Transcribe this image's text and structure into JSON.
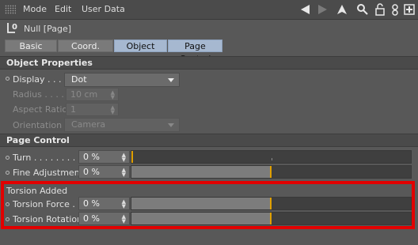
{
  "menubar": {
    "items": [
      "Mode",
      "Edit",
      "User Data"
    ]
  },
  "toolbar": {
    "icons": [
      "back-arrow-icon",
      "forward-arrow-icon",
      "up-arrow-icon",
      "search-icon",
      "lock-icon",
      "settings-icon",
      "new-panel-icon"
    ]
  },
  "object": {
    "name": "Null [Page]"
  },
  "tabs": [
    {
      "label": "Basic",
      "active": false
    },
    {
      "label": "Coord.",
      "active": false
    },
    {
      "label": "Object",
      "active": true
    },
    {
      "label": "Page Control",
      "active": true
    }
  ],
  "object_properties": {
    "header": "Object Properties",
    "display": {
      "label": "Display . . . .",
      "value": "Dot"
    },
    "radius": {
      "label": "Radius . . . .",
      "value": "10 cm"
    },
    "aspect_ratio": {
      "label": "Aspect Ratio",
      "value": "1"
    },
    "orientation": {
      "label": "Orientation",
      "value": "Camera"
    }
  },
  "page_control": {
    "header": "Page Control",
    "turn": {
      "label": "Turn . . . . . . . . .",
      "value": "0 %",
      "fill": 0
    },
    "fine_adjustment": {
      "label": "Fine Adjustment",
      "value": "0 %",
      "fill": 0.5
    }
  },
  "torsion_added": {
    "header": "Torsion Added",
    "torsion_force": {
      "label": "Torsion Force . .",
      "value": "0 %",
      "fill": 0.5
    },
    "torsion_rotation": {
      "label": "Torsion Rotation",
      "value": "0 %",
      "fill": 0.5
    }
  },
  "colors": {
    "highlight": "#e10000",
    "slider_marker": "#e0a000",
    "active_tab": "#a6b8d0"
  }
}
